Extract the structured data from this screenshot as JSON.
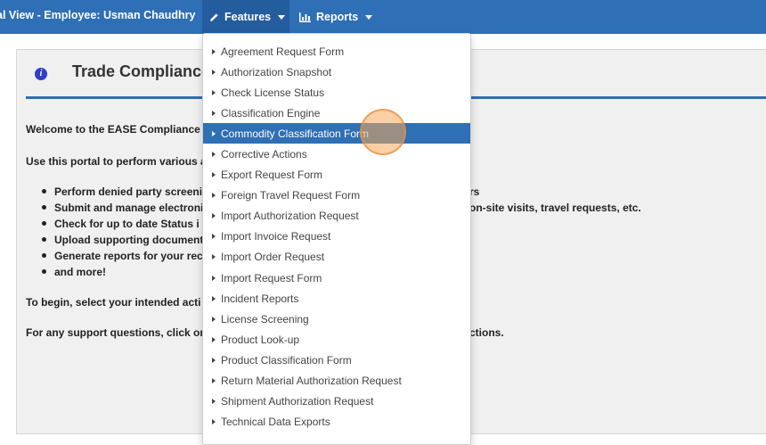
{
  "navbar": {
    "title": "al View - Employee: Usman Chaudhry",
    "features_label": "Features",
    "reports_label": "Reports"
  },
  "panel": {
    "title": "Trade Compliance",
    "welcome": "Welcome to the EASE Compliance",
    "intro": "Use this portal to perform various a",
    "bullets": [
      "Perform denied party screeni",
      "Submit and manage electroni",
      "Check for up to date Status i",
      "Upload supporting document",
      "Generate reports for your rec",
      "and more!"
    ],
    "right_fragments": {
      "bullet1": "rs",
      "bullet2": "on-site visits, travel requests, etc.",
      "support": "ctions."
    },
    "begin": "To begin, select your intended acti",
    "support": "For any support questions, click on"
  },
  "dropdown": {
    "items": [
      {
        "label": "Agreement Request Form"
      },
      {
        "label": "Authorization Snapshot"
      },
      {
        "label": "Check License Status"
      },
      {
        "label": "Classification Engine"
      },
      {
        "label": "Commodity Classification Form",
        "active": true
      },
      {
        "label": "Corrective Actions"
      },
      {
        "label": "Export Request Form"
      },
      {
        "label": "Foreign Travel Request Form"
      },
      {
        "label": "Import Authorization Request"
      },
      {
        "label": "Import Invoice Request"
      },
      {
        "label": "Import Order Request"
      },
      {
        "label": "Import Request Form"
      },
      {
        "label": "Incident Reports"
      },
      {
        "label": "License Screening"
      },
      {
        "label": "Product Look-up"
      },
      {
        "label": "Product Classification Form"
      },
      {
        "label": "Return Material Authorization Request"
      },
      {
        "label": "Shipment Authorization Request"
      },
      {
        "label": "Technical Data Exports"
      }
    ]
  },
  "colors": {
    "navbar": "#2e6fb5",
    "active_item": "#2e6fb5",
    "click_ring": "#f5aa5a"
  },
  "icons": {
    "features": "pencil-icon",
    "reports": "bar-chart-icon",
    "info": "info-icon"
  }
}
